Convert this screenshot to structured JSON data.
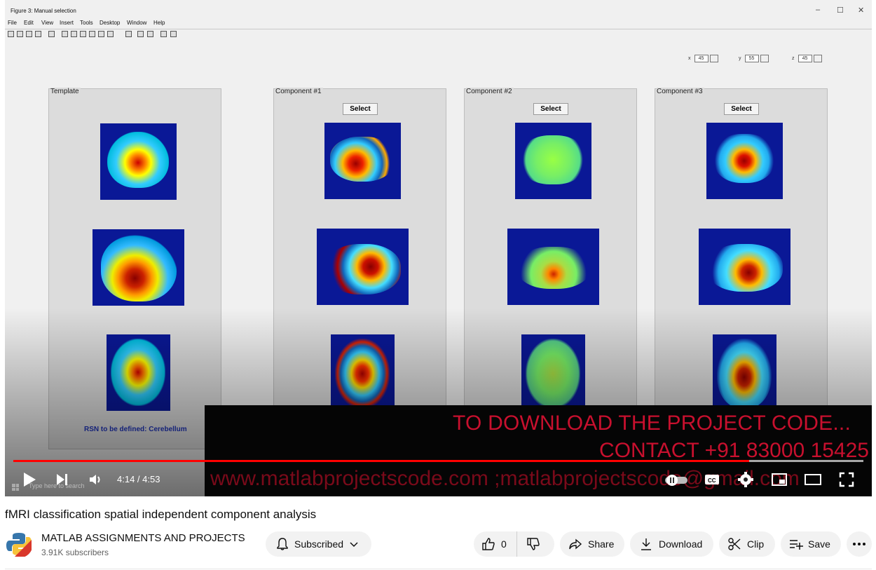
{
  "matlab": {
    "window_title": "Figure 3: Manual selection",
    "win_controls": [
      "–",
      "☐",
      "✕"
    ],
    "menu": [
      "File",
      "Edit",
      "View",
      "Insert",
      "Tools",
      "Desktop",
      "Window",
      "Help"
    ],
    "coords": [
      {
        "label": "x",
        "value": "45"
      },
      {
        "label": "y",
        "value": "55"
      },
      {
        "label": "z",
        "value": "45"
      }
    ],
    "panels": [
      {
        "title": "Template",
        "has_select": false
      },
      {
        "title": "Component #1",
        "has_select": true
      },
      {
        "title": "Component #2",
        "has_select": true
      },
      {
        "title": "Component #3",
        "has_select": true
      }
    ],
    "select_label": "Select",
    "rsn_text": "RSN to be defined: Cerebellum",
    "colors": {
      "brain_bg": "#0a1896",
      "panel_bg": "#dcdcdc"
    }
  },
  "overlay": {
    "line1": "TO DOWNLOAD THE PROJECT CODE...",
    "line2": "CONTACT +91 83000 15425",
    "line3": "www.matlabprojectscode.com ;matlabprojectscode@gmail.com",
    "color": "#c8102e"
  },
  "player": {
    "time": "4:14 / 4:53",
    "progress_fraction": 0.866,
    "taskbar_search": "Type here to search"
  },
  "video": {
    "title": "fMRI classification spatial independent component analysis"
  },
  "channel": {
    "name": "MATLAB ASSIGNMENTS AND PROJECTS",
    "subscribers": "3.91K subscribers",
    "subscribed_label": "Subscribed"
  },
  "actions": {
    "like_count": "0",
    "share_label": "Share",
    "download_label": "Download",
    "clip_label": "Clip",
    "save_label": "Save"
  }
}
